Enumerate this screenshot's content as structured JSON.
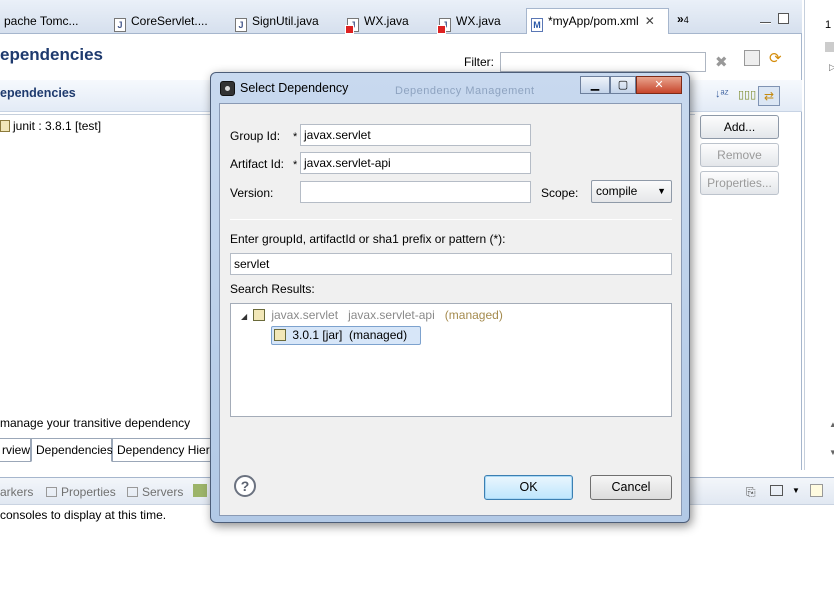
{
  "editor_tabs": [
    {
      "label": "pache Tomc...",
      "icon": "server-icon"
    },
    {
      "label": "CoreServlet....",
      "icon": "java-file-icon"
    },
    {
      "label": "SignUtil.java",
      "icon": "java-file-icon"
    },
    {
      "label": "WX.java",
      "icon": "java-error-file-icon"
    },
    {
      "label": "WX.java",
      "icon": "java-error-file-icon"
    },
    {
      "label": "*myApp/pom.xml",
      "icon": "xml-file-icon",
      "close": "✕"
    }
  ],
  "tab_overflow": {
    "label": "»",
    "count": "4"
  },
  "editor": {
    "title": "ependencies",
    "filter_label": "Filter:",
    "filter_value": "",
    "section_title": "ependencies",
    "dependency_item": "junit : 3.8.1 [test]",
    "buttons": {
      "add": "Add...",
      "remove": "Remove",
      "properties": "Properties..."
    },
    "transitive_text": "manage your transitive dependency",
    "page_tabs": [
      "rview",
      "Dependencies",
      "Dependency Hiera"
    ]
  },
  "views": {
    "tabs": [
      "arkers",
      "Properties",
      "Servers"
    ],
    "console_msg": "consoles to display at this time."
  },
  "right_strip": {
    "label": "1"
  },
  "dialog": {
    "title": "Select Dependency",
    "ghost_title": "Dependency Management",
    "group_id_label": "Group Id:",
    "group_id_value": "javax.servlet",
    "artifact_id_label": "Artifact Id:",
    "artifact_id_value": "javax.servlet-api",
    "version_label": "Version:",
    "version_value": "",
    "scope_label": "Scope:",
    "scope_value": "compile",
    "search_prompt": "Enter groupId, artifactId or sha1 prefix or pattern (*):",
    "search_value": "servlet",
    "results_label": "Search Results:",
    "results": [
      {
        "group": "javax.servlet",
        "artifact": "javax.servlet-api",
        "tag": "(managed)"
      },
      {
        "version": "3.0.1 [jar]",
        "tag": "(managed)"
      }
    ],
    "ok_label": "OK",
    "cancel_label": "Cancel",
    "required_marker": "*"
  }
}
